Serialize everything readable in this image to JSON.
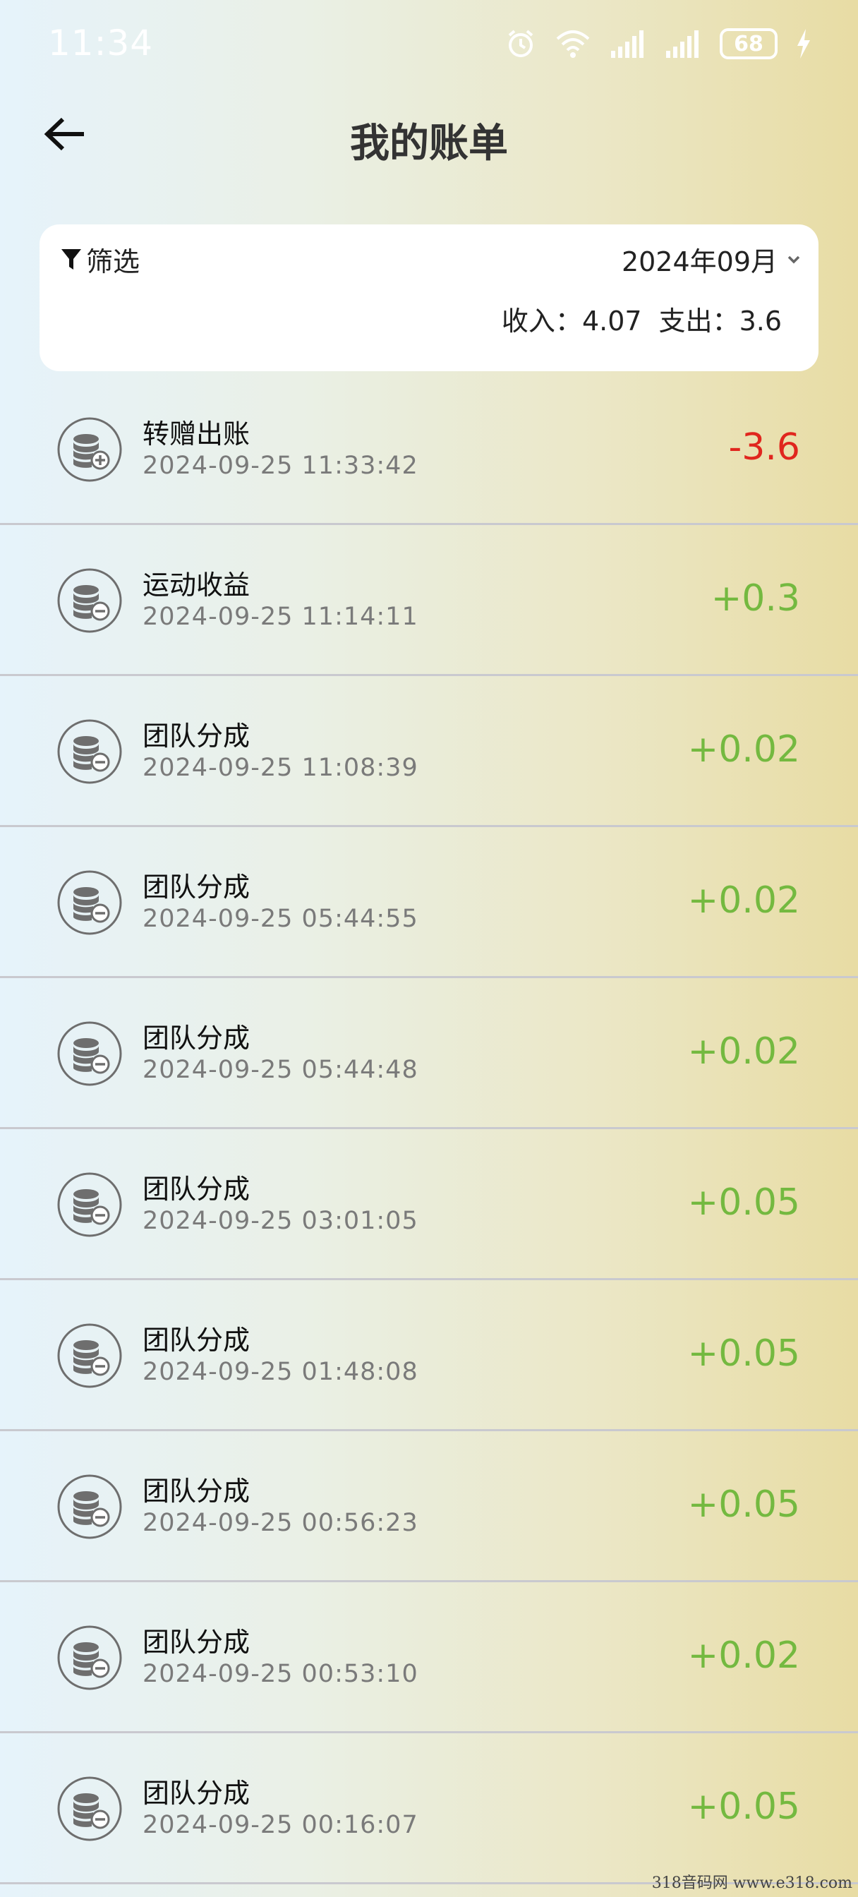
{
  "status_bar": {
    "time": "11:34",
    "battery": "68",
    "icons": [
      "alarm-icon",
      "wifi-icon",
      "signal-icon",
      "signal-icon",
      "battery-icon",
      "charging-icon"
    ]
  },
  "header": {
    "back_icon": "arrow-left-icon",
    "title": "我的账单"
  },
  "filter": {
    "label": "筛选",
    "icon": "filter-icon",
    "month": "2024年09月",
    "income_label": "收入：",
    "income_value": "4.07",
    "expense_label": "支出：",
    "expense_value": "3.6"
  },
  "transactions": [
    {
      "title": "转赠出账",
      "time": "2024-09-25 11:33:42",
      "amount": "-3.6",
      "type": "out",
      "icon": "coins-plus-icon"
    },
    {
      "title": "运动收益",
      "time": "2024-09-25 11:14:11",
      "amount": "+0.3",
      "type": "in",
      "icon": "coins-minus-icon"
    },
    {
      "title": "团队分成",
      "time": "2024-09-25 11:08:39",
      "amount": "+0.02",
      "type": "in",
      "icon": "coins-minus-icon"
    },
    {
      "title": "团队分成",
      "time": "2024-09-25 05:44:55",
      "amount": "+0.02",
      "type": "in",
      "icon": "coins-minus-icon"
    },
    {
      "title": "团队分成",
      "time": "2024-09-25 05:44:48",
      "amount": "+0.02",
      "type": "in",
      "icon": "coins-minus-icon"
    },
    {
      "title": "团队分成",
      "time": "2024-09-25 03:01:05",
      "amount": "+0.05",
      "type": "in",
      "icon": "coins-minus-icon"
    },
    {
      "title": "团队分成",
      "time": "2024-09-25 01:48:08",
      "amount": "+0.05",
      "type": "in",
      "icon": "coins-minus-icon"
    },
    {
      "title": "团队分成",
      "time": "2024-09-25 00:56:23",
      "amount": "+0.05",
      "type": "in",
      "icon": "coins-minus-icon"
    },
    {
      "title": "团队分成",
      "time": "2024-09-25 00:53:10",
      "amount": "+0.02",
      "type": "in",
      "icon": "coins-minus-icon"
    },
    {
      "title": "团队分成",
      "time": "2024-09-25 00:16:07",
      "amount": "+0.05",
      "type": "in",
      "icon": "coins-minus-icon"
    }
  ],
  "colors": {
    "negative": "#e0261e",
    "positive": "#74b940"
  },
  "watermark": "318音码网  www.e318.com"
}
